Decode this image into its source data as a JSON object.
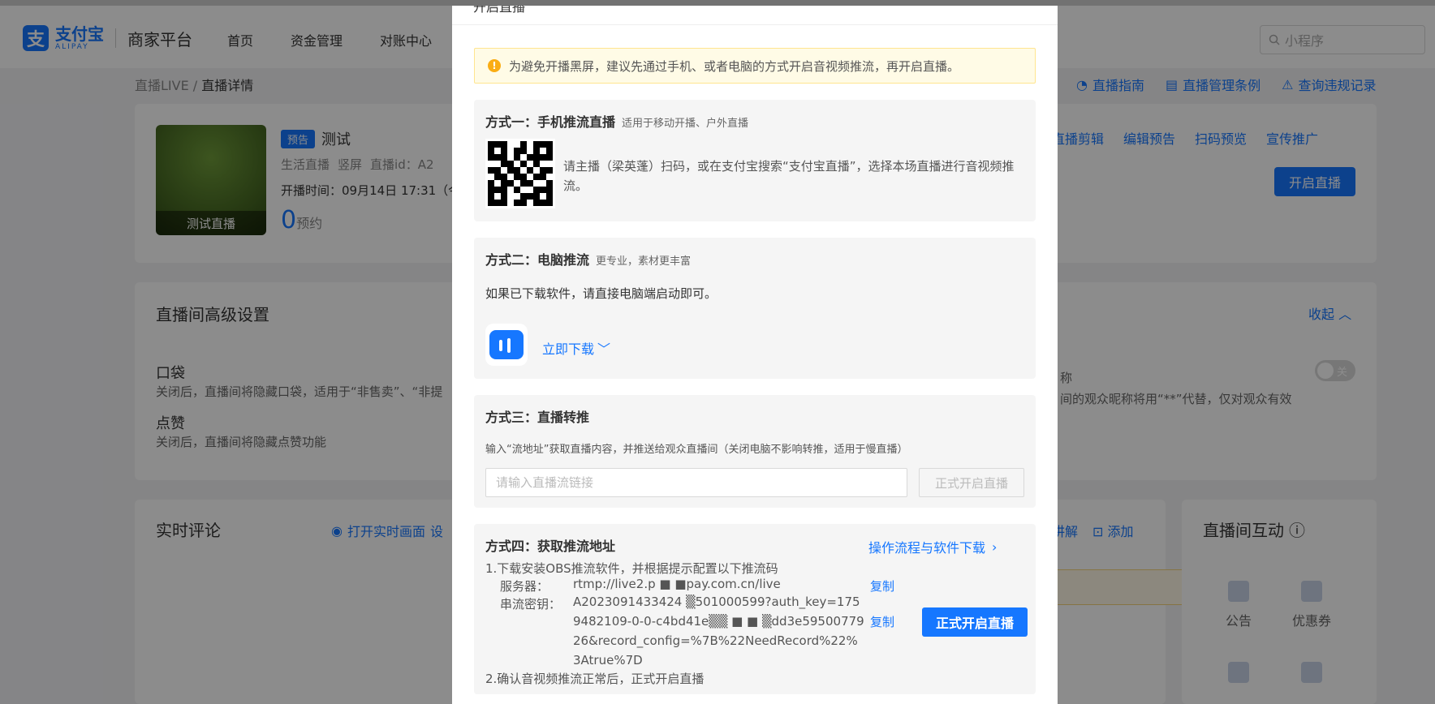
{
  "header": {
    "logo_cn": "支付宝",
    "logo_en": "ALIPAY",
    "platform": "商家平台",
    "nav": [
      "首页",
      "资金管理",
      "对账中心"
    ],
    "search_placeholder": "小程序"
  },
  "breadcrumb": {
    "root": "直播LIVE",
    "separator": "/",
    "current": "直播详情"
  },
  "guides": [
    "直播指南",
    "直播管理条例",
    "查询违规记录"
  ],
  "live": {
    "thumb_label": "测试直播",
    "tag": "预告",
    "title": "测试",
    "meta": [
      "生活直播",
      "竖屏",
      "直播id：A2"
    ],
    "time": "开播时间：09月14日 17:31（今",
    "count": "0",
    "count_unit": "预约",
    "actions": [
      "直播剪辑",
      "编辑预告",
      "扫码预览",
      "宣传推广"
    ],
    "start_button": "开启直播"
  },
  "advanced": {
    "title": "直播间高级设置",
    "collapse": "收起",
    "options": [
      {
        "title": "口袋",
        "desc": "关闭后，直播间将隐藏口袋，适用于“非售卖”、“非提"
      },
      {
        "title": "点赞",
        "desc": "关闭后，直播间将隐藏点赞功能"
      }
    ],
    "right_title_frag": "称",
    "right_desc_frag": "间的观众昵称将用“**”代替，仅对观众有效",
    "toggle_label": "关"
  },
  "comments": {
    "title": "实时评论",
    "open_screen": "打开实时画面",
    "open_frag": "设",
    "right_actions": [
      "讲解",
      "添加"
    ]
  },
  "interaction": {
    "title": "直播间互动",
    "items": [
      "公告",
      "优惠券"
    ]
  },
  "modal": {
    "title_fragment": "开启直播",
    "warning": "为避免开播黑屏，建议先通过手机、或者电脑的方式开启音视频推流，再开启直播。",
    "method1": {
      "title": "方式一：手机推流直播",
      "subtitle": "适用于移动开播、户外直播",
      "text": "请主播（梁英蓬）扫码，或在支付宝搜索“支付宝直播”，选择本场直播进行音视频推流。"
    },
    "method2": {
      "title": "方式二：电脑推流",
      "subtitle": "更专业，素材更丰富",
      "line": "如果已下载软件，请直接电脑端启动即可。",
      "download": "立即下载"
    },
    "method3": {
      "title": "方式三：直播转推",
      "desc": "输入“流地址”获取直播内容，并推送给观众直播间（关闭电脑不影响转推，适用于慢直播）",
      "input_placeholder": "请输入直播流链接",
      "button": "正式开启直播"
    },
    "method4": {
      "title": "方式四：获取推流地址",
      "guide_link": "操作流程与软件下载",
      "step1": "1.下载安装OBS推流软件，并根据提示配置以下推流码",
      "server_label": "服务器：",
      "server_value": "rtmp://live2.p ■ ■pay.com.cn/live",
      "key_label": "串流密钥：",
      "key_value": "A2023091433424 ▒501000599?auth_key=1759482109-0-0-c4bd41e▒▒ ■ ■ ▒dd3e5950077926&record_config=%7B%22NeedRecord%22%3Atrue%7D",
      "copy": "复制",
      "step2": "2.确认音视频推流正常后，正式开启直播",
      "button": "正式开启直播"
    }
  }
}
